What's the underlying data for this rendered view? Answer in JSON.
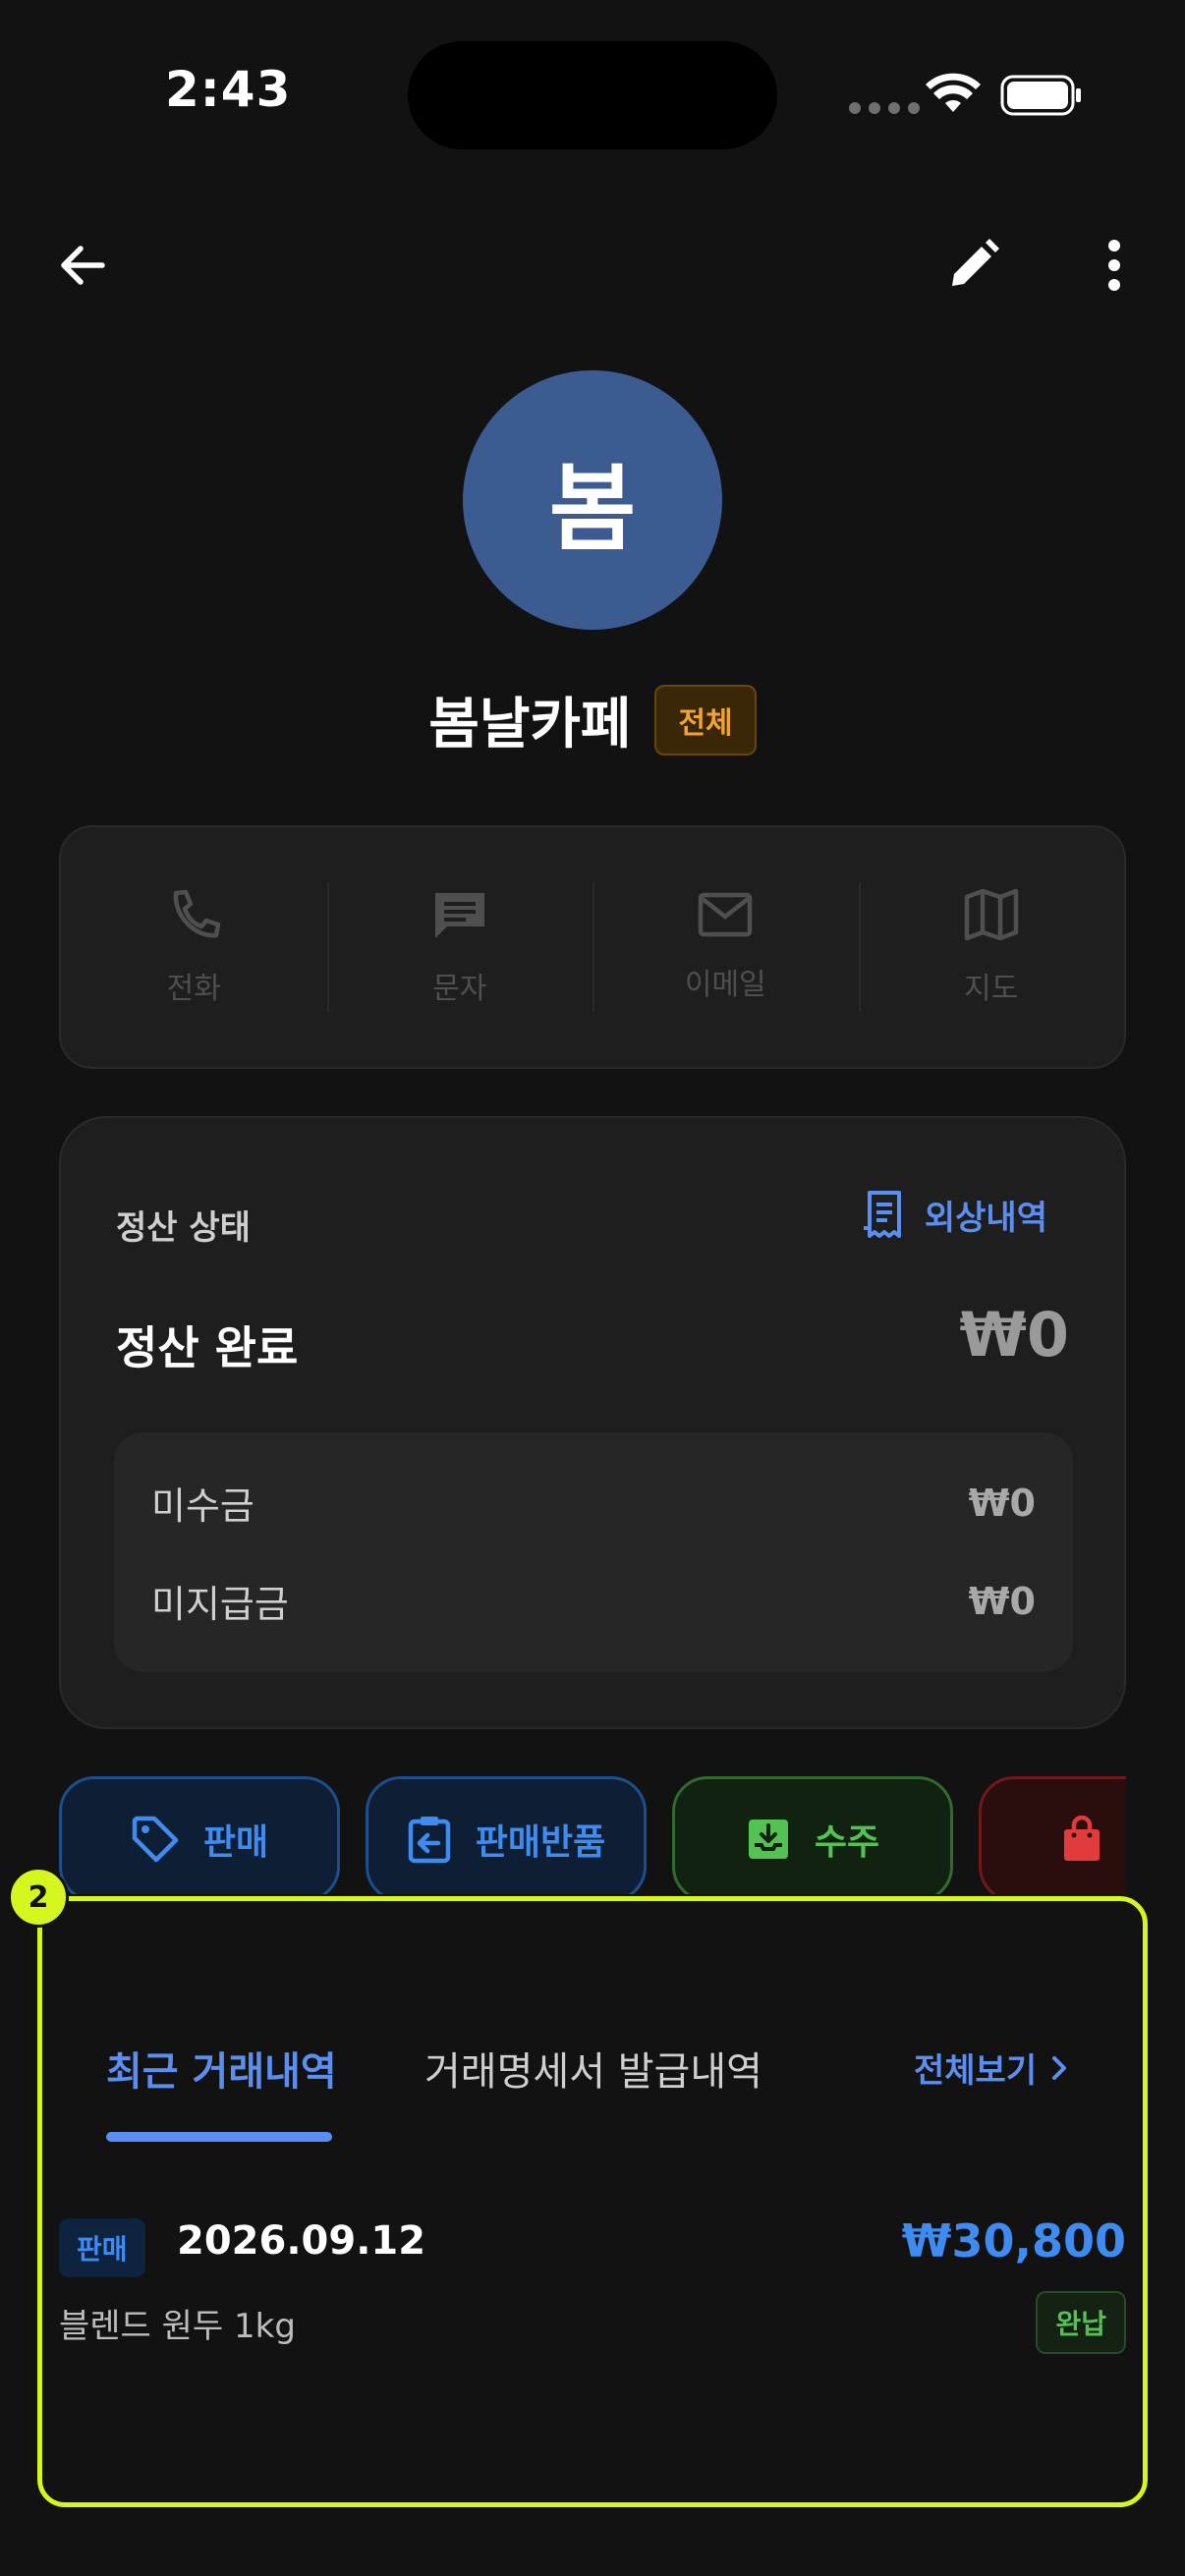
{
  "status_bar": {
    "time": "2:43"
  },
  "profile": {
    "avatar_text": "봄",
    "name": "봄날카페",
    "badge": "전체"
  },
  "contact": [
    {
      "label": "전화",
      "icon": "phone-icon"
    },
    {
      "label": "문자",
      "icon": "message-icon"
    },
    {
      "label": "이메일",
      "icon": "mail-icon"
    },
    {
      "label": "지도",
      "icon": "map-icon"
    }
  ],
  "settlement": {
    "title": "정산 상태",
    "ledger_link": "외상내역",
    "status": "정산 완료",
    "amount": "₩0",
    "receivable_label": "미수금",
    "receivable_value": "₩0",
    "payable_label": "미지급금",
    "payable_value": "₩0"
  },
  "actions": {
    "sale": "판매",
    "sale_return": "판매반품",
    "order": "수주"
  },
  "tabs": {
    "recent": "최근 거래내역",
    "invoice": "거래명세서 발급내역",
    "view_all": "전체보기"
  },
  "transactions": [
    {
      "type": "판매",
      "date": "2026.09.12",
      "amount": "₩30,800",
      "item": "블렌드 원두 1kg",
      "status": "완납"
    }
  ],
  "annotation": {
    "marker": "2"
  },
  "colors": {
    "accent": "#5b8ef0",
    "highlight": "#d7f51e",
    "avatar_bg": "#3c5b90",
    "sale": "#3e8bf2",
    "order": "#54c155",
    "purchase": "#e23b3b"
  }
}
